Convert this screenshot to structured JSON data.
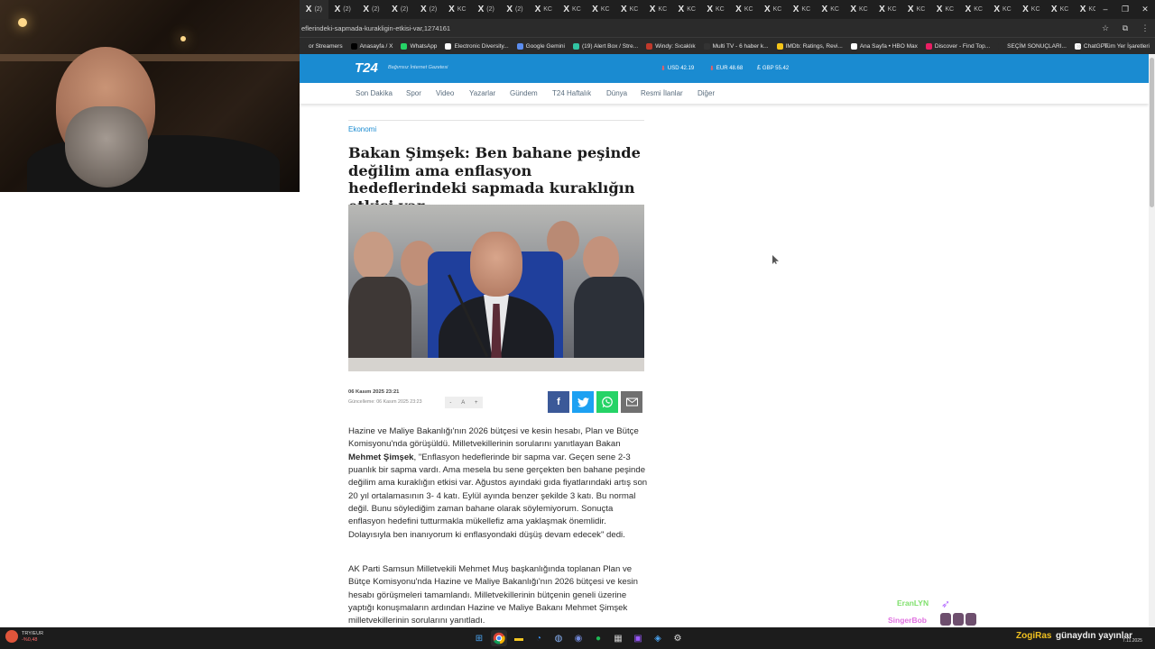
{
  "browser": {
    "tabs": [
      {
        "x": "X",
        "c": "(2)"
      },
      {
        "x": "X",
        "c": "(2)"
      },
      {
        "x": "X",
        "c": "(2)"
      },
      {
        "x": "X",
        "c": "(2)"
      },
      {
        "x": "X",
        "c": "(2)"
      },
      {
        "x": "X",
        "c": "KC"
      },
      {
        "x": "X",
        "c": "(2)"
      },
      {
        "x": "X",
        "c": "(2)"
      },
      {
        "x": "X",
        "c": "KC"
      },
      {
        "x": "X",
        "c": "KC"
      },
      {
        "x": "X",
        "c": "KC"
      },
      {
        "x": "X",
        "c": "KC"
      },
      {
        "x": "X",
        "c": "KC"
      },
      {
        "x": "X",
        "c": "KC"
      },
      {
        "x": "X",
        "c": "KC"
      },
      {
        "x": "X",
        "c": "KC"
      },
      {
        "x": "X",
        "c": "KC"
      },
      {
        "x": "X",
        "c": "KC"
      },
      {
        "x": "X",
        "c": "KC"
      },
      {
        "x": "X",
        "c": "KC"
      },
      {
        "x": "X",
        "c": "KC"
      },
      {
        "x": "X",
        "c": "KC"
      },
      {
        "x": "X",
        "c": "KC"
      },
      {
        "x": "X",
        "c": "KC"
      },
      {
        "x": "X",
        "c": "KC"
      },
      {
        "x": "X",
        "c": "KC"
      },
      {
        "x": "X",
        "c": "KC"
      },
      {
        "x": "X",
        "c": "KC"
      }
    ],
    "new_tab": "+",
    "url": "eflerindeki-sapmada-kurakligin-etkisi-var,1274161",
    "bookmarks": [
      {
        "label": "or Streamers",
        "color": "#2b2b2b"
      },
      {
        "label": "Anasayfa / X",
        "color": "#000000"
      },
      {
        "label": "WhatsApp",
        "color": "#25d366"
      },
      {
        "label": "Electronic Diversity...",
        "color": "#ffffff"
      },
      {
        "label": "Google Gemini",
        "color": "#5b8def"
      },
      {
        "label": "(19) Alert Box / Stre...",
        "color": "#31c3a2"
      },
      {
        "label": "Windy: Sıcaklık",
        "color": "#c0392b"
      },
      {
        "label": "Multi TV - 6 haber k...",
        "color": "#333333"
      },
      {
        "label": "IMDb: Ratings, Revi...",
        "color": "#f5c518"
      },
      {
        "label": "Ana Sayfa • HBO Max",
        "color": "#ffffff"
      },
      {
        "label": "Discover - Find Top...",
        "color": "#e91e63"
      },
      {
        "label": "SEÇİM SONUÇLARI...",
        "color": "#2b2b2b"
      },
      {
        "label": "ChatGPT",
        "color": "#ffffff"
      }
    ],
    "bookmarks_more": "»",
    "all_bookmarks": "Tüm Yer İşaretleri"
  },
  "site": {
    "logo": "T24",
    "slogan": "Bağımsız İnternet Gazetesi",
    "fx": [
      {
        "label": "USD 42.19",
        "arrow": "down"
      },
      {
        "label": "EUR 48.68",
        "arrow": "down"
      },
      {
        "label": "GBP 55.42",
        "arrow": "none"
      }
    ],
    "nav": [
      "Son Dakika",
      "Spor",
      "Video",
      "Yazarlar",
      "Gündem",
      "T24 Haftalık",
      "Dünya",
      "Resmi İlanlar",
      "Diğer"
    ]
  },
  "article": {
    "category": "Ekonomi",
    "title": "Bakan Şimşek: Ben bahane peşinde değilim ama enflasyon hedeflerindeki sapmada kuraklığın etkisi var",
    "published": "06 Kasım 2025 23:21",
    "updated": "Güncelleme: 06 Kasım 2025 23:23",
    "font_ctrl": {
      "minus": "-",
      "a": "A",
      "plus": "+"
    },
    "para1_pre": "Hazine ve Maliye Bakanlığı'nın 2026 bütçesi ve kesin hesabı, Plan ve Bütçe Komisyonu'nda görüşüldü. Milletvekillerinin sorularını yanıtlayan Bakan ",
    "para1_bold": "Mehmet Şimşek",
    "para1_post": ", \"Enflasyon hedeflerinde bir sapma var. Geçen sene 2-3 puanlık bir sapma vardı. Ama mesela bu sene gerçekten ben bahane peşinde değilim ama kuraklığın etkisi var. Ağustos ayındaki gıda fiyatlarındaki artış son 20 yıl ortalamasının 3- 4 katı. Eylül ayında benzer şekilde 3 katı. Bu normal değil. Bunu söylediğim zaman bahane olarak söylemiyorum. Sonuçta enflasyon hedefini tutturmakla mükellefiz ama yaklaşmak önemlidir. Dolayısıyla ben inanıyorum ki enflasyondaki düşüş devam edecek\" dedi.",
    "para2": "AK Parti Samsun Milletvekili Mehmet Muş başkanlığında toplanan Plan ve Bütçe Komisyonu'nda Hazine ve Maliye Bakanlığı'nın 2026 bütçesi ve kesin hesabı görüşmeleri tamamlandı. Milletvekillerinin bütçenin geneli üzerine yaptığı konuşmaların ardından Hazine ve Maliye Bakanı Mehmet Şimşek milletvekillerinin sorularını yanıtladı."
  },
  "overlay": {
    "chat1": "EranLYN",
    "chat2": "SingerBob",
    "stream_user": "ZogiRas",
    "stream_msg": "günaydın yayınlar"
  },
  "taskbar": {
    "ticker_label": "TRY/EUR",
    "ticker_change": "-%0,48",
    "clock": "7.11.2025"
  }
}
